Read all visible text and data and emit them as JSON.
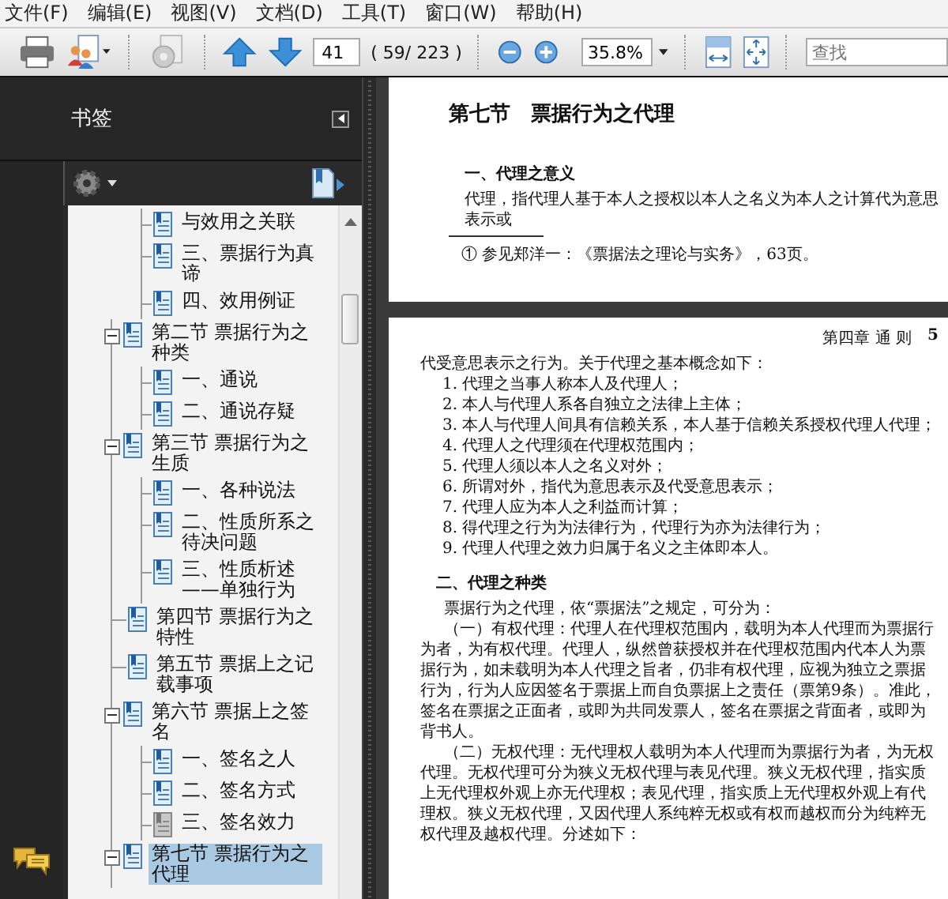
{
  "menu": [
    "文件(F)",
    "编辑(E)",
    "视图(V)",
    "文档(D)",
    "工具(T)",
    "窗口(W)",
    "帮助(H)"
  ],
  "toolbar": {
    "page_field": {
      "value": "41"
    },
    "page_count": "( 59/ 223 )",
    "zoom_field": {
      "value": "35.8%"
    },
    "search_field": {
      "placeholder": "查找"
    }
  },
  "bookmarks_panel": {
    "title": "书签",
    "continued_items": [
      {
        "label": "与效用之关联",
        "selected": false,
        "dimmed": false
      },
      {
        "label": "三、票据行为真谛",
        "selected": false,
        "dimmed": false
      },
      {
        "label": "四、效用例证",
        "selected": false,
        "dimmed": false
      }
    ],
    "items": [
      {
        "label": "第二节 票据行为之种类",
        "selected": false,
        "dimmed": false,
        "expanded": true,
        "children": [
          {
            "label": "一、通说",
            "selected": false,
            "dimmed": false
          },
          {
            "label": "二、通说存疑",
            "selected": false,
            "dimmed": false
          }
        ]
      },
      {
        "label": "第三节 票据行为之生质",
        "selected": false,
        "dimmed": false,
        "expanded": true,
        "children": [
          {
            "label": "一、各种说法",
            "selected": false,
            "dimmed": false
          },
          {
            "label": "二、性质所系之待决问题",
            "selected": false,
            "dimmed": false
          },
          {
            "label": "三、性质析述——单独行为",
            "selected": false,
            "dimmed": false
          }
        ]
      },
      {
        "label": "第四节 票据行为之特性",
        "selected": false,
        "dimmed": false
      },
      {
        "label": "第五节 票据上之记载事项",
        "selected": false,
        "dimmed": false
      },
      {
        "label": "第六节 票据上之签名",
        "selected": false,
        "dimmed": false,
        "expanded": true,
        "children": [
          {
            "label": "一、签名之人",
            "selected": false,
            "dimmed": false
          },
          {
            "label": "二、签名方式",
            "selected": false,
            "dimmed": false
          },
          {
            "label": "三、签名效力",
            "selected": false,
            "dimmed": true
          }
        ]
      },
      {
        "label": "第七节 票据行为之代理",
        "selected": true,
        "dimmed": false,
        "expanded": true
      }
    ]
  },
  "page_1": {
    "heading": "第七节　票据行为之代理",
    "subheading": "一、代理之意义",
    "paragraph": "代理，指代理人基于本人之授权以本人之名义为本人之计算代为意思表示或",
    "footnote": "① 参见郑洋一：《票据法之理论与实务》，63页。"
  },
  "page_2": {
    "running_header": "第四章 通 则",
    "page_number": "5",
    "intro": "代受意思表示之行为。关于代理之基本概念如下：",
    "list": [
      "1. 代理之当事人称本人及代理人；",
      "2. 本人与代理人系各自独立之法律上主体；",
      "3. 本人与代理人间具有信赖关系，本人基于信赖关系授权代理人代理；",
      "4. 代理人之代理须在代理权范围内；",
      "5. 代理人须以本人之名义对外；",
      "6. 所谓对外，指代为意思表示及代受意思表示；",
      "7. 代理人应为本人之利益而计算；",
      "8. 得代理之行为为法律行为，代理行为亦为法律行为；",
      "9. 代理人代理之效力归属于名义之主体即本人。"
    ],
    "subheading": "二、代理之种类",
    "paragraphs": [
      "票据行为之代理，依“票据法”之规定，可分为：",
      "（一）有权代理：代理人在代理权范围内，载明为本人代理而为票据行为者，为有权代理。代理人，纵然曾获授权并在代理权范围内代本人为票据行为，如未载明为本人代理之旨者，仍非有权代理，应视为独立之票据行为，行为人应因签名于票据上而自负票据上之责任（票第9条）。准此，签名在票据之正面者，或即为共同发票人，签名在票据之背面者，或即为背书人。",
      "（二）无权代理：无代理权人载明为本人代理而为票据行为者，为无权代理。无权代理可分为狭义无权代理与表见代理。狭义无权代理，指实质上无代理权外观上亦无代理权；表见代理，指实质上无代理权外观上有代理权。狭义无权代理，又因代理人系纯粹无权或有权而越权而分为纯粹无权代理及越权代理。分述如下："
    ]
  }
}
